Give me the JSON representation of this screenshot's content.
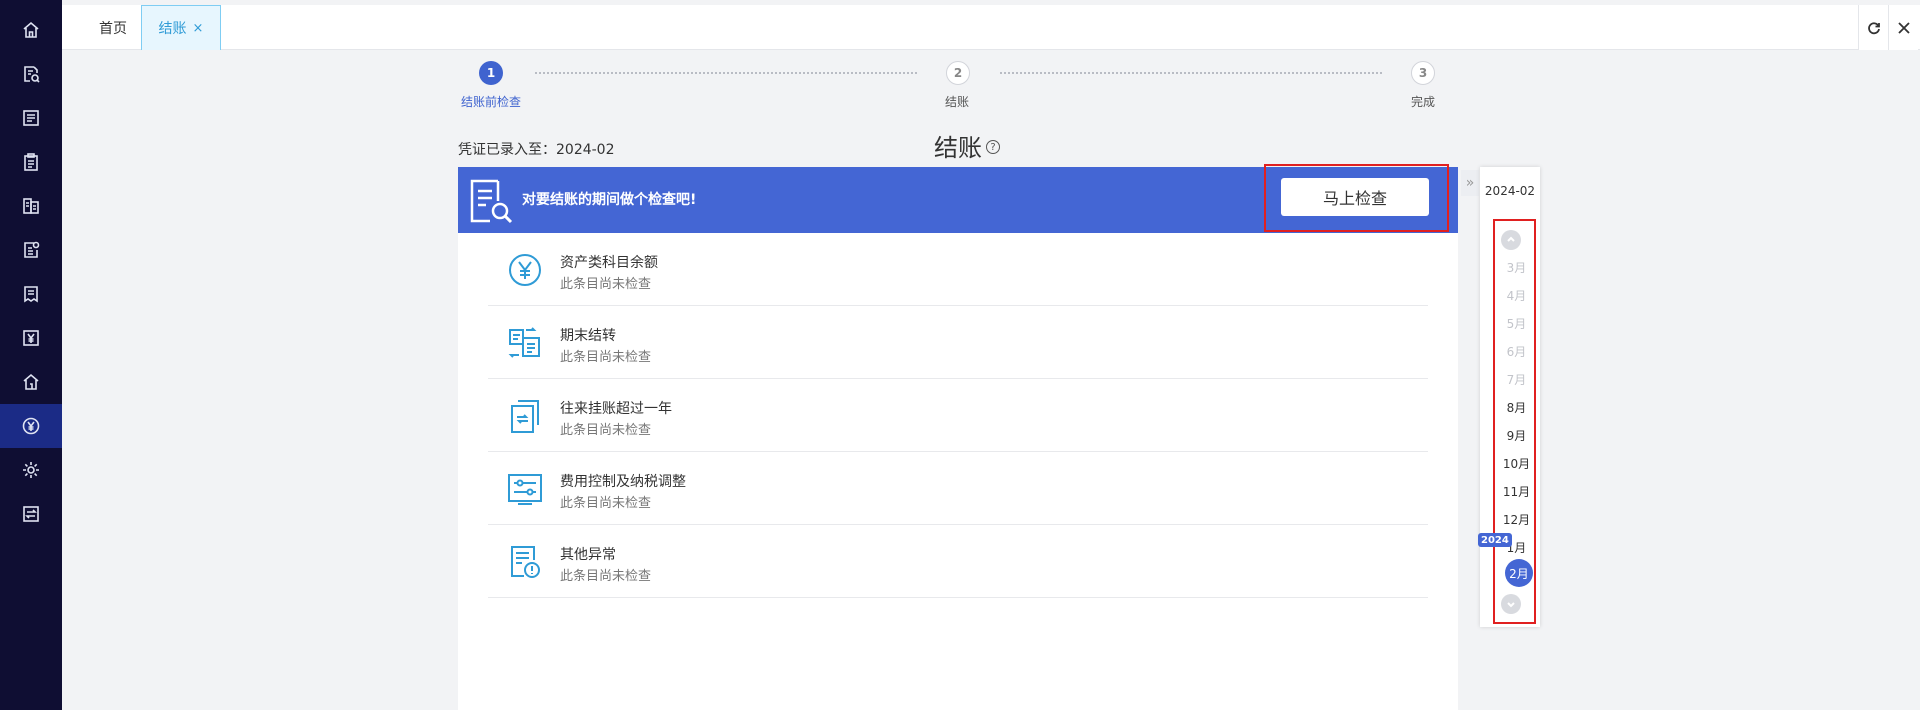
{
  "sidebar": {
    "items": [
      {
        "icon": "home-icon"
      },
      {
        "icon": "voucher-search-icon"
      },
      {
        "icon": "ledger-icon"
      },
      {
        "icon": "clipboard-icon"
      },
      {
        "icon": "report-icon"
      },
      {
        "icon": "invoice-icon"
      },
      {
        "icon": "document-icon"
      },
      {
        "icon": "yuan-icon"
      },
      {
        "icon": "building-icon"
      },
      {
        "icon": "closing-icon",
        "active": true
      },
      {
        "icon": "gear-icon"
      },
      {
        "icon": "transfer-icon"
      }
    ],
    "active_color": "#1b2b86",
    "background": "#0f0e33"
  },
  "tabs": {
    "home": "首页",
    "current": "结账",
    "current_close": "×"
  },
  "toolbar": {
    "refresh_icon": "refresh-icon",
    "close_icon": "close-icon"
  },
  "steps": [
    {
      "number": "1",
      "label": "结账前检查",
      "active": true
    },
    {
      "number": "2",
      "label": "结账",
      "active": false
    },
    {
      "number": "3",
      "label": "完成",
      "active": false
    }
  ],
  "page": {
    "recorded_to": "凭证已录入至：2024-02",
    "title": "结账",
    "help": "?"
  },
  "banner": {
    "text": "对要结账的期间做个检查吧!",
    "button": "马上检查",
    "color": "#4466d4"
  },
  "checks": [
    {
      "icon": "yuan-circle-icon",
      "name": "资产类科目余额",
      "status": "此条目尚未检查"
    },
    {
      "icon": "transfer-doc-icon",
      "name": "期末结转",
      "status": "此条目尚未检查"
    },
    {
      "icon": "pending-doc-icon",
      "name": "往来挂账超过一年",
      "status": "此条目尚未检查"
    },
    {
      "icon": "sliders-icon",
      "name": "费用控制及纳税调整",
      "status": "此条目尚未检查"
    },
    {
      "icon": "alert-doc-icon",
      "name": "其他异常",
      "status": "此条目尚未检查"
    }
  ],
  "period_picker": {
    "collapse": "»",
    "current": "2024-02",
    "year_badge": "2024",
    "months": [
      {
        "label": "3月",
        "disabled": true
      },
      {
        "label": "4月",
        "disabled": true
      },
      {
        "label": "5月",
        "disabled": true
      },
      {
        "label": "6月",
        "disabled": true
      },
      {
        "label": "7月",
        "disabled": true
      },
      {
        "label": "8月",
        "disabled": false
      },
      {
        "label": "9月",
        "disabled": false
      },
      {
        "label": "10月",
        "disabled": false
      },
      {
        "label": "11月",
        "disabled": false
      },
      {
        "label": "12月",
        "disabled": false
      },
      {
        "label": "1月",
        "disabled": false
      },
      {
        "label": "2月",
        "disabled": false,
        "selected": true
      }
    ]
  }
}
